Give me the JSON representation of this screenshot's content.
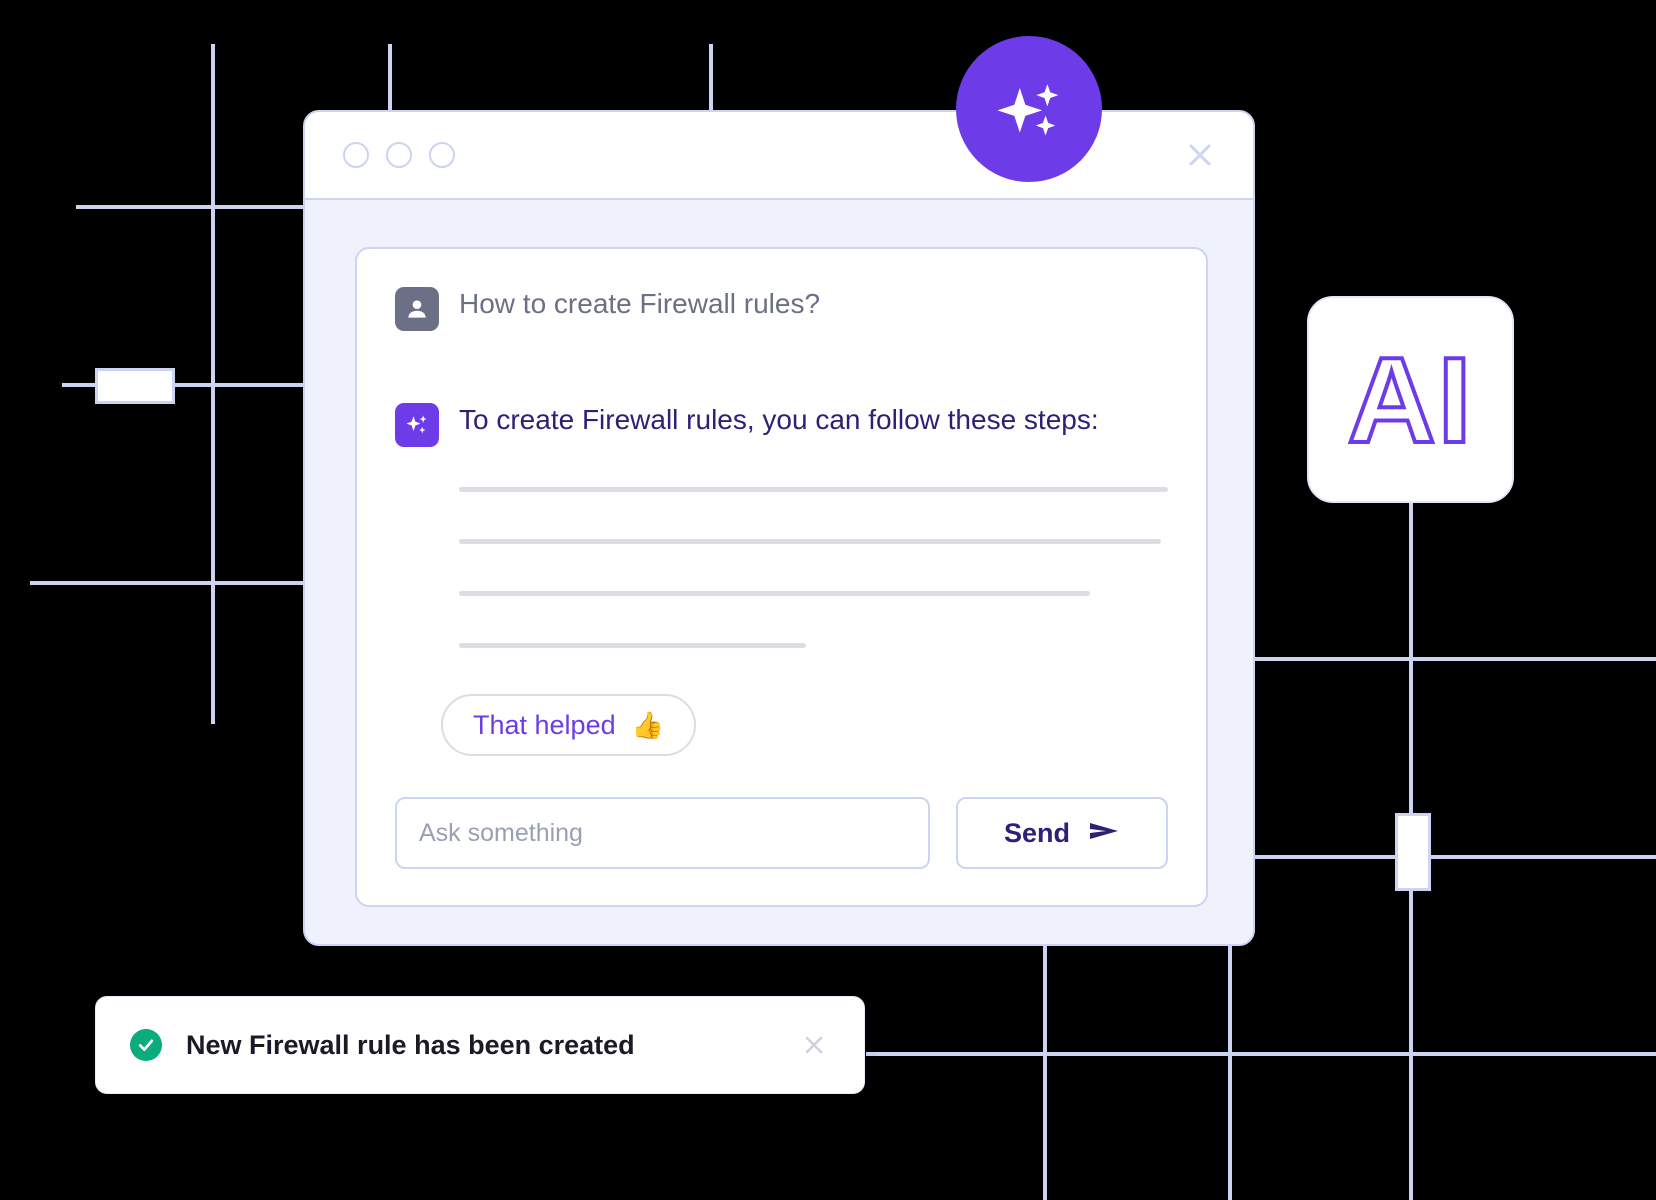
{
  "colors": {
    "accent_purple": "#6d3ce8",
    "deep_purple_text": "#2d2176",
    "grid_line": "#ccd4f2",
    "panel_bg": "#eff1fd",
    "user_gray": "#6b7086",
    "success_green": "#0aab7c",
    "skeleton_gray": "#dcdde2"
  },
  "decor": {
    "ai_badge_label": "AI",
    "ai_badge_icon": "ai-outline-text",
    "sparkle_icon": "sparkles-icon"
  },
  "window": {
    "traffic_lights": [
      "window-dot-1",
      "window-dot-2",
      "window-dot-3"
    ],
    "close_icon": "close-icon"
  },
  "chat": {
    "messages": [
      {
        "role": "user",
        "avatar_icon": "user-avatar-icon",
        "text": "How to create Firewall rules?"
      },
      {
        "role": "assistant",
        "avatar_icon": "sparkles-icon",
        "text": "To create Firewall rules, you can follow these steps:"
      }
    ],
    "skeleton_line_widths": [
      "100%",
      "99%",
      "89%",
      "49%"
    ],
    "feedback_button": {
      "label": "That helped",
      "emoji": "👍",
      "icon": "thumbs-up-icon"
    }
  },
  "composer": {
    "input_placeholder": "Ask something",
    "input_value": "",
    "send_label": "Send",
    "send_icon": "paper-plane-icon"
  },
  "toast": {
    "status_icon": "check-circle-icon",
    "message": "New Firewall rule has been created",
    "close_icon": "close-icon"
  }
}
